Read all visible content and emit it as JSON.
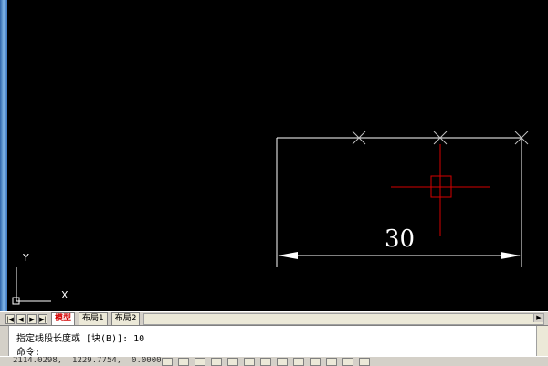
{
  "dimension": {
    "value": "30"
  },
  "ucs": {
    "y_label": "Y",
    "x_label": "X"
  },
  "tabs": [
    {
      "label": "模型",
      "active": true
    },
    {
      "label": "布局1",
      "active": false
    },
    {
      "label": "布局2",
      "active": false
    }
  ],
  "nav_buttons": [
    "|◀",
    "◀",
    "▶",
    "▶|"
  ],
  "command": {
    "history": "指定线段长度或 [块(B)]: 10",
    "prompt": "命令:"
  },
  "status": {
    "coords": "2114.0298,  1229.7754,  0.0000"
  },
  "colors": {
    "background": "#000000",
    "geometry": "#ffffff",
    "cursor": "#d40000",
    "marker": "#c0c0c0"
  }
}
